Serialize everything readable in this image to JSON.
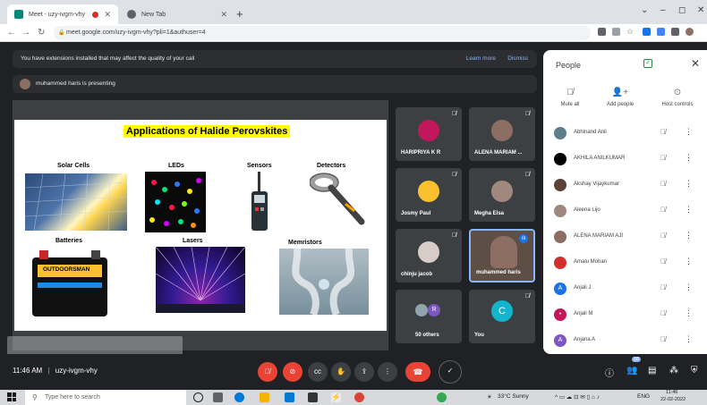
{
  "browser": {
    "tabs": [
      {
        "title": "Meet - uzy-ivgm-vhy",
        "active": true
      },
      {
        "title": "New Tab",
        "active": false
      }
    ],
    "url": "meet.google.com/uzy-ivgm-vhy?pli=1&authuser=4",
    "colors": {
      "meet_fav": "#00897b",
      "ext1": "#1a73e8",
      "ext2": "#5f6368"
    }
  },
  "banner": {
    "message": "You have extensions installed that may affect the quality of your call",
    "learn_more": "Learn more",
    "dismiss": "Dismiss"
  },
  "presenting": {
    "text": "muhammed haris is presenting"
  },
  "slide": {
    "title": "Applications of Halide Perovskites",
    "items": [
      "Solar Cells",
      "LEDs",
      "Sensors",
      "Detectors",
      "Batteries",
      "Lasers",
      "Memristors"
    ],
    "battery_brand": "OUTDOORSMAN"
  },
  "tiles": [
    {
      "name": "HARIPRIYA K R",
      "color": "#c2185b"
    },
    {
      "name": "ALENA MARIAM ...",
      "color": "#8d6e63"
    },
    {
      "name": "Josmy Paul",
      "color": "#fbc02d"
    },
    {
      "name": "Megha Elsa",
      "color": "#a1887f"
    },
    {
      "name": "chinju jacob",
      "color": "#d7ccc8"
    },
    {
      "name": "muhammed haris",
      "color": "#795548"
    },
    {
      "name": "50 others",
      "color": "#7e57c2"
    },
    {
      "name": "You",
      "color": "#12b5cb",
      "initial": "C"
    }
  ],
  "others_badge": "R",
  "panel": {
    "title": "People",
    "actions": [
      {
        "label": "Mute all",
        "icon": "mic-off-icon"
      },
      {
        "label": "Add people",
        "icon": "add-person-icon"
      },
      {
        "label": "Host controls",
        "icon": "toggle-icon"
      }
    ],
    "people": [
      {
        "name": "Abhinand Anil",
        "color": "#607d8b",
        "initial": ""
      },
      {
        "name": "AKHILA ANILKUMAR",
        "color": "#000000",
        "initial": ""
      },
      {
        "name": "Akshay Vijaykumar",
        "color": "#5d4037",
        "initial": ""
      },
      {
        "name": "Aleena Lijo",
        "color": "#a1887f",
        "initial": ""
      },
      {
        "name": "ALENA MARIAM AJI",
        "color": "#8d6e63",
        "initial": ""
      },
      {
        "name": "Amalu Mohan",
        "color": "#d32f2f",
        "initial": ""
      },
      {
        "name": "Anjali J",
        "color": "#1a73e8",
        "initial": "A"
      },
      {
        "name": "Anjali M",
        "color": "#c2185b",
        "initial": "•"
      },
      {
        "name": "Anjana A",
        "color": "#7e57c2",
        "initial": "A"
      }
    ]
  },
  "controls": {
    "time": "11:46 AM",
    "meeting_code": "uzy-ivgm-vhy",
    "participants_count": "58"
  },
  "taskbar": {
    "search_placeholder": "Type here to search",
    "weather": "33°C  Sunny",
    "lang": "ENG",
    "time": "11:46",
    "date": "22-02-2022"
  }
}
